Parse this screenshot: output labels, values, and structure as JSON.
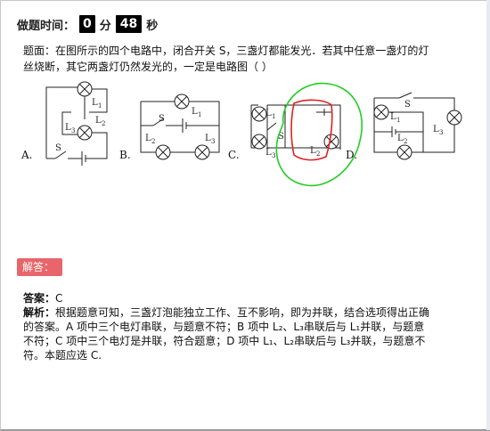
{
  "timer": {
    "label": "做题时间：",
    "minutes": "0",
    "min_unit": "分",
    "seconds": "48",
    "sec_unit": "秒"
  },
  "question": {
    "line1": "题面：在图所示的四个电路中，闭合开关 S，三盏灯都能发光．若其中任意一盏灯的灯",
    "line2": "丝烧断，其它两盏灯仍然发光的，一定是电路图（        ）"
  },
  "circuits": {
    "options": [
      "A.",
      "B.",
      "C.",
      "D."
    ],
    "lamp_labels": {
      "L1": "L",
      "sub1": "1",
      "sub2": "2",
      "sub3": "3"
    },
    "switch_label": "S"
  },
  "answer_tag": "解答：",
  "answer": {
    "answer_label": "答案：",
    "answer_value": "C",
    "analysis_label": "解析：",
    "line1": "根据题意可知，三盏灯泡能独立工作、互不影响，即为并联，结合选项得出正确",
    "line2": "的答案。A 项中三个电灯串联，与题意不符；B 项中 L₂、L₃串联后与 L₁并联，与题意",
    "line3": "不符；C 项中三个电灯是并联，符合题意；D 项中 L₁、L₂串联后与 L₃并联，与题意不",
    "line4": "符。本题应选 C."
  },
  "colors": {
    "timer_box": "#000000",
    "answer_tag": "#e8666b",
    "green_annotation": "#22cc22",
    "red_annotation": "#dd2222"
  }
}
